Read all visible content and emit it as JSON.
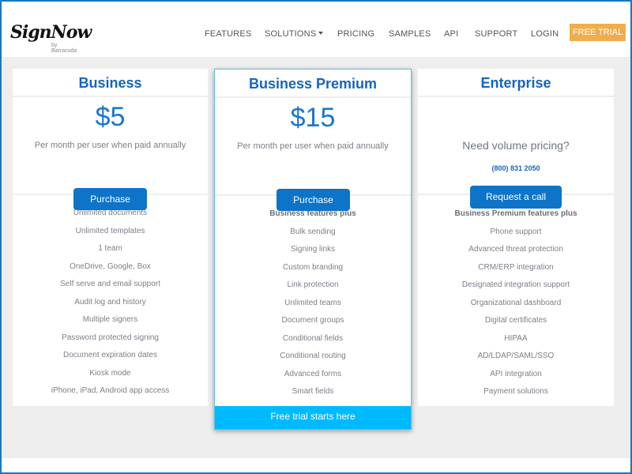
{
  "brand": {
    "logo_text": "SignNow",
    "logo_sub": "by Barracuda"
  },
  "nav": {
    "items": [
      {
        "label": "FEATURES"
      },
      {
        "label": "SOLUTIONS",
        "has_dropdown": true
      },
      {
        "label": "PRICING"
      },
      {
        "label": "SAMPLES"
      },
      {
        "label": "API"
      },
      {
        "label": "SUPPORT"
      },
      {
        "label": "LOGIN"
      }
    ],
    "cta_label": "FREE TRIAL",
    "cta_color": "#f0ad4e"
  },
  "colors": {
    "accent": "#1976d2",
    "button": "#0d74c8",
    "trial_bar": "#00baff",
    "frame": "#1a78c2",
    "highlight_border": "#5bc0de"
  },
  "plans": [
    {
      "title": "Business",
      "price": "$5",
      "price_note": "Per month per user when paid annually",
      "button_label": "Purchase",
      "features": [
        "Unlimited documents",
        "Unlimited templates",
        "1 team",
        "OneDrive, Google, Box",
        "Self serve and email support",
        "Audit log and history",
        "Multiple signers",
        "Password protected signing",
        "Document expiration dates",
        "Kiosk mode",
        "iPhone, iPad, Android app access"
      ]
    },
    {
      "title": "Business Premium",
      "price": "$15",
      "price_note": "Per month per user when paid annually",
      "button_label": "Purchase",
      "features_heading": "Business features plus",
      "features": [
        "Bulk sending",
        "Signing links",
        "Custom branding",
        "Link protection",
        "Unlimited teams",
        "Document groups",
        "Conditional fields",
        "Conditional routing",
        "Advanced forms",
        "Smart fields"
      ],
      "trial_label": "Free trial starts here"
    },
    {
      "title": "Enterprise",
      "volume_question": "Need volume pricing?",
      "phone": "(800) 831 2050",
      "button_label": "Request a call",
      "features_heading": "Business Premium features plus",
      "features": [
        "Phone support",
        "Advanced threat protection",
        "CRM/ERP integration",
        "Designated integration support",
        "Organizational dashboard",
        "Digital certificates",
        "HIPAA",
        "AD/LDAP/SAML/SSO",
        "API integration",
        "Payment solutions"
      ]
    }
  ]
}
